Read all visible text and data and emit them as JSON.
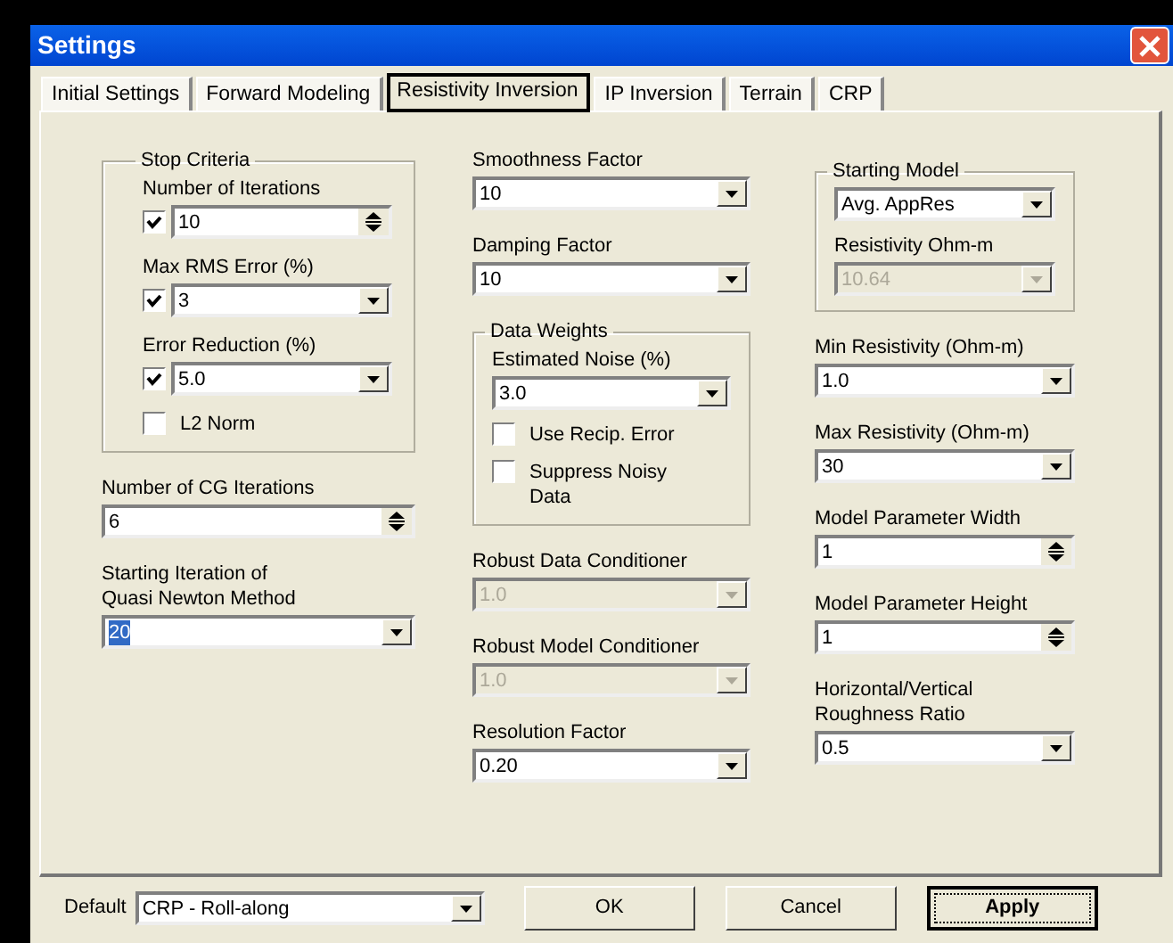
{
  "window": {
    "title": "Settings"
  },
  "tabs": [
    {
      "label": "Initial Settings",
      "selected": false
    },
    {
      "label": "Forward Modeling",
      "selected": false
    },
    {
      "label": "Resistivity Inversion",
      "selected": true
    },
    {
      "label": "IP Inversion",
      "selected": false
    },
    {
      "label": "Terrain",
      "selected": false
    },
    {
      "label": "CRP",
      "selected": false
    }
  ],
  "columns": [
    [
      {
        "kind": "group",
        "title": "Stop Criteria",
        "items": [
          {
            "kind": "spin",
            "label": "Number of Iterations",
            "value": "10",
            "checked": true,
            "disabled": false,
            "text_selected": false
          },
          {
            "kind": "combo",
            "label": "Max RMS Error (%)",
            "value": "3",
            "checked": true,
            "disabled": false,
            "text_selected": false
          },
          {
            "kind": "combo",
            "label": "Error Reduction (%)",
            "value": "5.0",
            "checked": true,
            "disabled": false,
            "text_selected": false
          },
          {
            "kind": "checkbox",
            "label": "L2 Norm",
            "checked": false
          }
        ]
      },
      {
        "kind": "spin",
        "label": "Number of CG Iterations",
        "value": "6",
        "disabled": false,
        "text_selected": false
      },
      {
        "kind": "combo",
        "label": "Starting Iteration of\nQuasi Newton Method",
        "value": "20",
        "disabled": false,
        "text_selected": true
      }
    ],
    [
      {
        "kind": "combo",
        "label": "Smoothness Factor",
        "value": "10",
        "disabled": false,
        "text_selected": false
      },
      {
        "kind": "combo",
        "label": "Damping Factor",
        "value": "10",
        "disabled": false,
        "text_selected": false
      },
      {
        "kind": "group",
        "title": "Data Weights",
        "items": [
          {
            "kind": "combo",
            "label": "Estimated Noise (%)",
            "value": "3.0",
            "disabled": false,
            "text_selected": false
          },
          {
            "kind": "checkbox",
            "label": "Use Recip. Error",
            "checked": false
          },
          {
            "kind": "checkbox",
            "label": "Suppress Noisy\nData",
            "checked": false
          }
        ]
      },
      {
        "kind": "combo",
        "label": "Robust Data Conditioner",
        "value": "1.0",
        "disabled": true,
        "text_selected": false
      },
      {
        "kind": "combo",
        "label": "Robust Model Conditioner",
        "value": "1.0",
        "disabled": true,
        "text_selected": false
      },
      {
        "kind": "combo",
        "label": "Resolution Factor",
        "value": "0.20",
        "disabled": false,
        "text_selected": false
      }
    ],
    [
      {
        "kind": "group",
        "title": "Starting Model",
        "items": [
          {
            "kind": "combo",
            "value": "Avg. AppRes",
            "disabled": false,
            "text_selected": false
          },
          {
            "kind": "combo",
            "label": "Resistivity Ohm-m",
            "value": "10.64",
            "disabled": true,
            "text_selected": false
          }
        ]
      },
      {
        "kind": "combo",
        "label": "Min Resistivity (Ohm-m)",
        "value": "1.0",
        "disabled": false,
        "text_selected": false
      },
      {
        "kind": "combo",
        "label": "Max Resistivity (Ohm-m)",
        "value": "30",
        "disabled": false,
        "text_selected": false
      },
      {
        "kind": "spin",
        "label": "Model Parameter Width",
        "value": "1",
        "disabled": false,
        "text_selected": false
      },
      {
        "kind": "spin",
        "label": "Model Parameter Height",
        "value": "1",
        "disabled": false,
        "text_selected": false
      },
      {
        "kind": "combo",
        "label": "Horizontal/Vertical\nRoughness Ratio",
        "value": "0.5",
        "disabled": false,
        "text_selected": false
      }
    ]
  ],
  "footer": {
    "default_label": "Default",
    "default_value": "CRP - Roll-along",
    "buttons": [
      {
        "label": "OK",
        "default": false
      },
      {
        "label": "Cancel",
        "default": false
      },
      {
        "label": "Apply",
        "default": true
      }
    ]
  }
}
